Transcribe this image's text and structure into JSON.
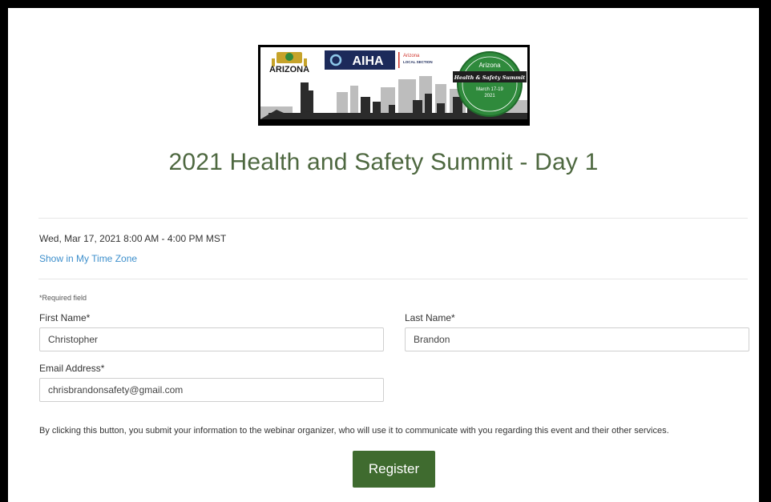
{
  "banner": {
    "state_text": "ARIZONA",
    "org_text": "AIHA",
    "section_line1": "Arizona",
    "section_line2": "LOCAL SECTION",
    "badge_line1": "Arizona",
    "badge_ribbon": "Health & Safety Summit",
    "badge_line2": "March 17-19",
    "badge_line3": "2021",
    "colors": {
      "badge_green": "#2f8a3c",
      "aiha_navy": "#1c2a5a",
      "skyline_dark": "#2b2b2b",
      "skyline_light": "#b5b5b5"
    }
  },
  "event": {
    "title": "2021 Health and Safety Summit - Day 1",
    "date_time": "Wed, Mar 17, 2021 8:00 AM - 4:00 PM MST",
    "timezone_link": "Show in My Time Zone"
  },
  "form": {
    "required_note": "*Required field",
    "first_name_label": "First Name*",
    "first_name_value": "Christopher",
    "last_name_label": "Last Name*",
    "last_name_value": "Brandon",
    "email_label": "Email Address*",
    "email_value": "chrisbrandonsafety@gmail.com",
    "disclaimer": "By clicking this button, you submit your information to the webinar organizer, who will use it to communicate with you regarding this event and their other services.",
    "register_label": "Register"
  },
  "colors": {
    "title_green": "#4e6840",
    "button_green": "#3f6b2f",
    "link_blue": "#3d8fcc"
  }
}
